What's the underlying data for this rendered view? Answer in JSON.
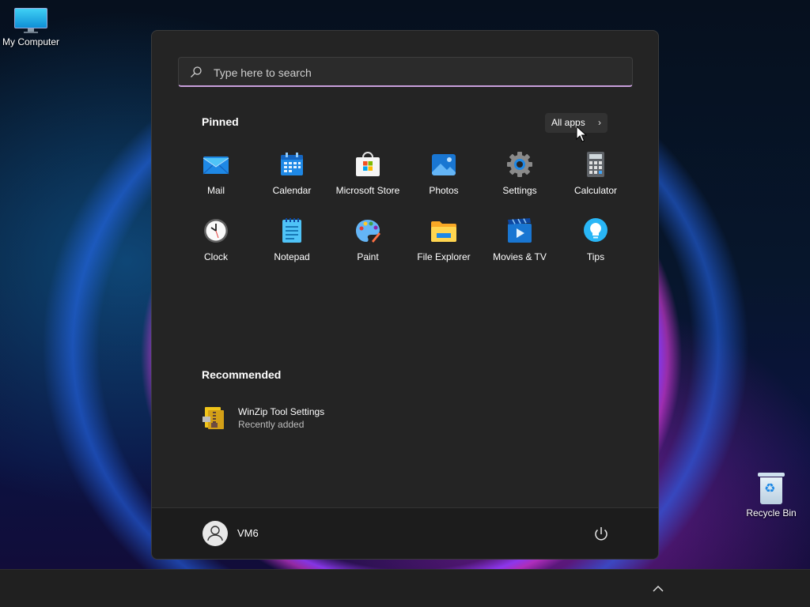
{
  "desktop": {
    "icons": [
      {
        "label": "My Computer",
        "icon": "monitor-icon"
      },
      {
        "label": "Recycle Bin",
        "icon": "recycle-bin-icon"
      }
    ]
  },
  "start_menu": {
    "search": {
      "placeholder": "Type here to search",
      "value": ""
    },
    "pinned": {
      "title": "Pinned",
      "all_apps_label": "All apps",
      "apps": [
        {
          "label": "Mail",
          "icon": "mail-icon"
        },
        {
          "label": "Calendar",
          "icon": "calendar-icon"
        },
        {
          "label": "Microsoft Store",
          "icon": "store-icon"
        },
        {
          "label": "Photos",
          "icon": "photos-icon"
        },
        {
          "label": "Settings",
          "icon": "gear-icon"
        },
        {
          "label": "Calculator",
          "icon": "calculator-icon"
        },
        {
          "label": "Clock",
          "icon": "clock-icon"
        },
        {
          "label": "Notepad",
          "icon": "notepad-icon"
        },
        {
          "label": "Paint",
          "icon": "paint-palette-icon"
        },
        {
          "label": "File Explorer",
          "icon": "folder-icon"
        },
        {
          "label": "Movies & TV",
          "icon": "movies-icon"
        },
        {
          "label": "Tips",
          "icon": "lightbulb-icon"
        }
      ]
    },
    "recommended": {
      "title": "Recommended",
      "items": [
        {
          "name": "WinZip Tool Settings",
          "subtitle": "Recently added",
          "icon": "winzip-icon"
        }
      ]
    },
    "footer": {
      "user_name": "VM6",
      "power_icon": "power-icon"
    }
  },
  "colors": {
    "menu_bg": "#242424",
    "footer_bg": "#1c1c1c",
    "taskbar_bg": "#202020",
    "search_accent": "#c9a0dc"
  }
}
